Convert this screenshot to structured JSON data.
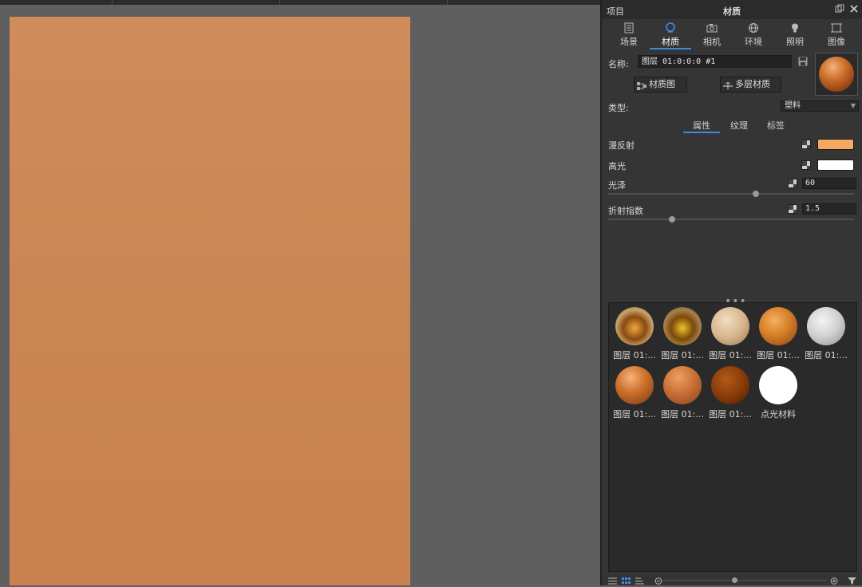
{
  "panel": {
    "project_label": "项目",
    "title": "材质",
    "tabs": [
      {
        "label": "场景",
        "icon": "scene-icon"
      },
      {
        "label": "材质",
        "icon": "material-icon",
        "active": true
      },
      {
        "label": "相机",
        "icon": "camera-icon"
      },
      {
        "label": "环境",
        "icon": "environment-icon"
      },
      {
        "label": "照明",
        "icon": "lighting-icon"
      },
      {
        "label": "图像",
        "icon": "image-icon"
      }
    ]
  },
  "material": {
    "name_label": "名称:",
    "name_value": "图层 01:0:0:0 #1",
    "material_graph_button": "材质图",
    "multi_layer_button": "多层材质",
    "type_label": "类型:",
    "type_value": "塑料",
    "subtabs": [
      "属性",
      "纹理",
      "标签"
    ],
    "diffuse_label": "漫反射",
    "diffuse_color": "#f5a862",
    "specular_label": "高光",
    "specular_color": "#ffffff",
    "gloss_label": "光泽",
    "gloss_value": "60",
    "gloss_fraction": 0.6,
    "ior_label": "折射指数",
    "ior_value": "1.5",
    "ior_fraction": 0.26,
    "more_dots": "•••"
  },
  "library": {
    "items": [
      {
        "label": "图层 01:...",
        "style": "glass-gold"
      },
      {
        "label": "图层 01:...",
        "style": "glass-amber"
      },
      {
        "label": "图层 01:...",
        "style": "satin-beige"
      },
      {
        "label": "图层 01:...",
        "style": "glossy-orange"
      },
      {
        "label": "图层 01:...",
        "style": "silver"
      },
      {
        "label": "图层 01:...",
        "style": "copper-glossy"
      },
      {
        "label": "图层 01:...",
        "style": "copper"
      },
      {
        "label": "图层 01:...",
        "style": "dark-copper"
      },
      {
        "label": "点光材料",
        "style": "white"
      }
    ]
  },
  "colors": {
    "canvas": "#c98552",
    "accent": "#3c8ce7"
  }
}
